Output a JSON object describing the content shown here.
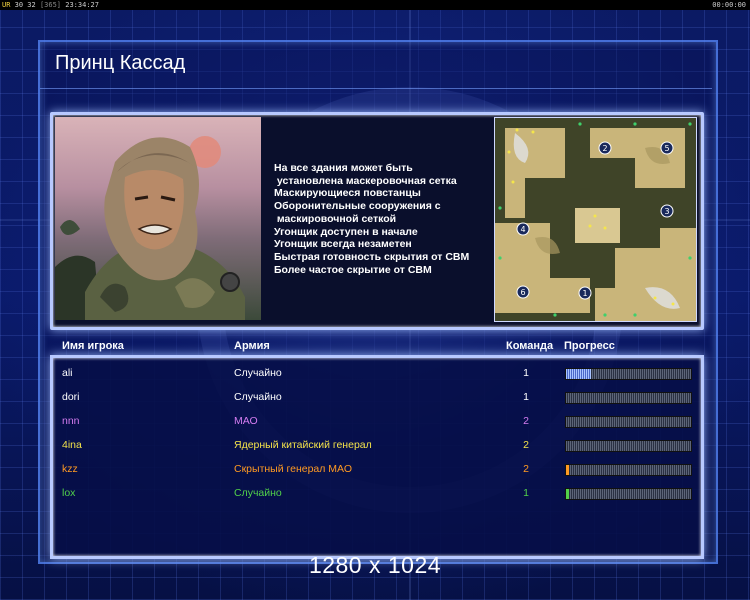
{
  "status_bar": {
    "left_tag": "UR",
    "left_numbers": "30 32",
    "left_bracket": "[365]",
    "clock": "23:34:27",
    "right_clock": "00:00:00"
  },
  "screen": {
    "title": "Принц Кассад",
    "resolution_label": "1280 x 1024"
  },
  "general": {
    "features": [
      "На все здания может быть",
      " установлена маскеровочная сетка",
      "Маскирующиеся повстанцы",
      "Оборонительные сооружения с",
      " маскировочной сеткой",
      "Угонщик доступен в начале",
      "Угонщик всегда незаметен",
      "Быстрая готовность скрытия от СВМ",
      "Более частое скрытие от СВМ"
    ]
  },
  "minimap": {
    "start_positions": [
      "1",
      "2",
      "3",
      "4",
      "5",
      "6"
    ]
  },
  "table": {
    "headers": {
      "player": "Имя игрока",
      "army": "Армия",
      "team": "Команда",
      "progress": "Прогресс"
    },
    "rows": [
      {
        "player": "ali",
        "army": "Случайно",
        "team": "1",
        "progress": 0.2,
        "color": "#ffffff"
      },
      {
        "player": "dori",
        "army": "Случайно",
        "team": "1",
        "progress": 0.0,
        "color": "#ffffff"
      },
      {
        "player": "nnn",
        "army": "МАО",
        "team": "2",
        "progress": 0.0,
        "color": "#d47cf0"
      },
      {
        "player": "4ina",
        "army": "Ядерный китайский генерал",
        "team": "2",
        "progress": 0.0,
        "color": "#f3e24a"
      },
      {
        "player": "kzz",
        "army": "Скрытный генерал МАО",
        "team": "2",
        "progress": 0.02,
        "color": "#ff9a22"
      },
      {
        "player": "lox",
        "army": "Случайно",
        "team": "1",
        "progress": 0.02,
        "color": "#52d14a"
      }
    ]
  },
  "colors": {
    "background": "#0a1550",
    "panel_border": "#b8c9ff",
    "progress_fill": "#a9c4ff"
  }
}
